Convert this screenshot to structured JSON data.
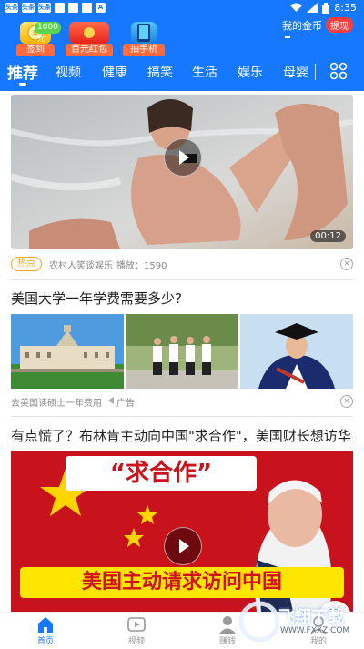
{
  "status_bar": {
    "time": "8:35",
    "app_tags": [
      "头条",
      "头条",
      "头条"
    ],
    "letter_icon": "A"
  },
  "header": {
    "promos": [
      {
        "label": "签到",
        "badge": "1000元"
      },
      {
        "label": "百元红包"
      },
      {
        "label": "抽手机"
      }
    ],
    "coins_label": "我的金币",
    "withdraw_label": "提现"
  },
  "tabs": [
    "推荐",
    "视频",
    "健康",
    "搞笑",
    "生活",
    "娱乐",
    "母婴"
  ],
  "feed": {
    "video1": {
      "duration": "00:12",
      "tag": "热点",
      "source": "农村人笑谈娱乐",
      "plays": "播放：1590"
    },
    "article": {
      "title": "美国大学一年学费需要多少?",
      "source": "去美国读硕士一年费用",
      "ad_label": "广告"
    },
    "video2": {
      "title": "有点慌了？布林肯主动向中国\"求合作\"，美国财长想访华",
      "overlay_quote": "“求合作”",
      "overlay_caption": "美国主动请求访问中国"
    }
  },
  "bottom_nav": [
    "首页",
    "视频",
    "赚钱",
    "我的"
  ],
  "watermark": {
    "text": "飞翔下载",
    "url": "WWW.FXXZ.COM"
  },
  "colors": {
    "primary": "#1677ff",
    "hot": "#f4a623",
    "withdraw": "#ff3b3b"
  }
}
